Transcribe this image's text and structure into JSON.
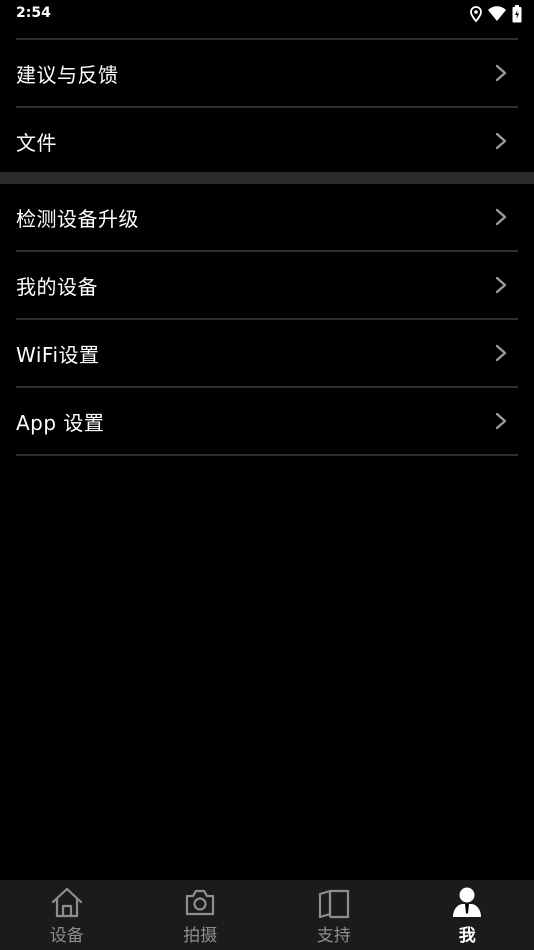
{
  "status_bar": {
    "time": "2:54",
    "icons": [
      "location-icon",
      "wifi-icon",
      "battery-icon"
    ]
  },
  "menu_group_1": [
    {
      "label": "建议与反馈",
      "icon": "chevron-right-icon"
    },
    {
      "label": "文件",
      "icon": "chevron-right-icon"
    }
  ],
  "menu_group_2": [
    {
      "label": "检测设备升级",
      "icon": "chevron-right-icon"
    },
    {
      "label": "我的设备",
      "icon": "chevron-right-icon"
    },
    {
      "label": "WiFi设置",
      "icon": "chevron-right-icon"
    },
    {
      "label": "App 设置",
      "icon": "chevron-right-icon"
    }
  ],
  "bottom_nav": {
    "tabs": [
      {
        "label": "设备",
        "icon": "home-icon",
        "active": false
      },
      {
        "label": "拍摄",
        "icon": "camera-icon",
        "active": false
      },
      {
        "label": "支持",
        "icon": "book-icon",
        "active": false
      },
      {
        "label": "我",
        "icon": "user-icon",
        "active": true
      }
    ]
  },
  "colors": {
    "background": "#000000",
    "divider": "#2e2e2e",
    "section_gap": "#2a2a2a",
    "nav_background": "#1b1b1b",
    "nav_inactive": "#8e8e8e",
    "nav_active": "#ffffff",
    "chevron": "#9a9a9a"
  }
}
